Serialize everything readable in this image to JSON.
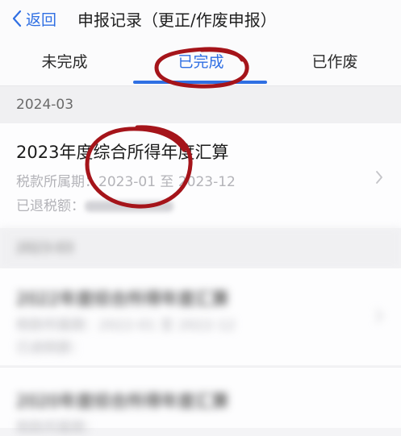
{
  "nav": {
    "back_label": "返回",
    "title": "申报记录（更正/作废申报）"
  },
  "tabs": [
    {
      "label": "未完成",
      "active": false
    },
    {
      "label": "已完成",
      "active": true
    },
    {
      "label": "已作废",
      "active": false
    }
  ],
  "accent_color": "#2f6fe3",
  "annotation_color": "#a5141a",
  "groups": [
    {
      "month": "2024-03",
      "record": {
        "title": "2023年度综合所得年度汇算",
        "period_label": "税款所属期：",
        "period_value": "2023-01 至 2023-12",
        "refund_label": "已退税额："
      }
    },
    {
      "month": "2023-03",
      "record": {
        "title": "2022年度综合所得年度汇算",
        "period_label": "税款所属期：",
        "period_value": "2022-01 至 2022-12",
        "refund_label": "已退税额："
      }
    },
    {
      "record": {
        "title": "2020年度综合所得年度汇算",
        "period_label": "税款所属期："
      }
    }
  ]
}
